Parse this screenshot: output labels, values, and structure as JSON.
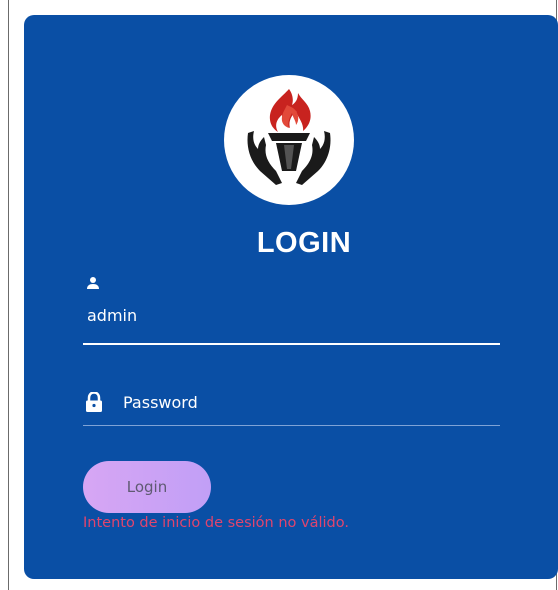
{
  "logo": {
    "icon": "torch-hands-icon",
    "colors": {
      "flame": "#c8231f",
      "hands": "#1a1a1a"
    }
  },
  "form": {
    "title": "LOGIN",
    "username": {
      "value": "admin",
      "icon": "user-icon"
    },
    "password": {
      "value": "",
      "placeholder": "Password",
      "icon": "lock-icon"
    },
    "submit_label": "Login",
    "error_message": "Intento de inicio de sesión no válido."
  },
  "colors": {
    "card_background": "#0a4fa5",
    "button_gradient_start": "#d7a6f4",
    "button_gradient_end": "#c19ff6",
    "error_text": "#e0456e"
  }
}
